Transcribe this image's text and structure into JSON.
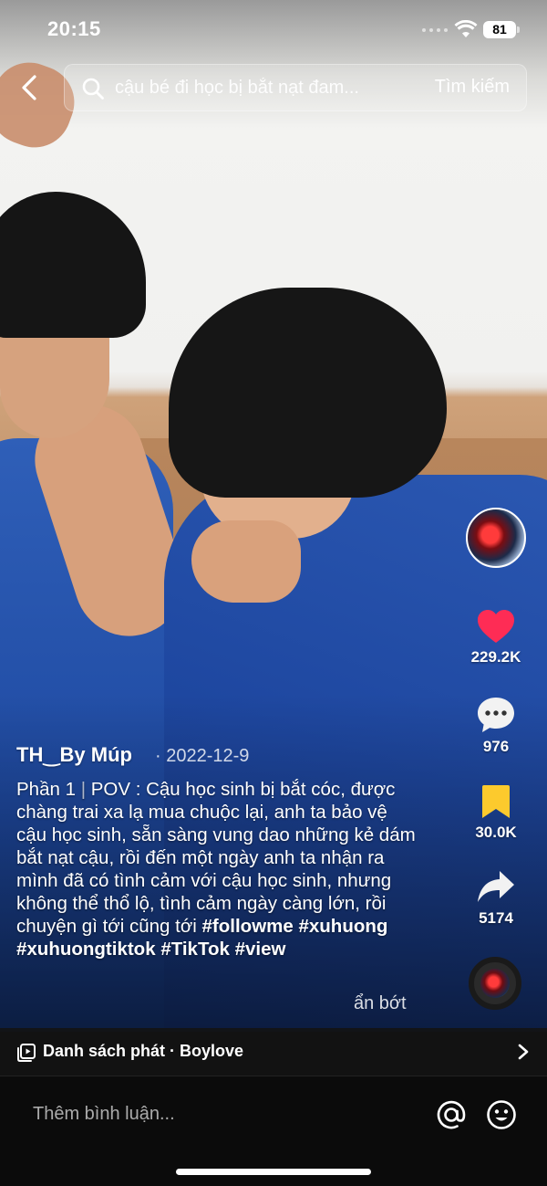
{
  "status_bar": {
    "time": "20:15",
    "battery": "81"
  },
  "search": {
    "query": "cậu bé đi học bị bắt nạt đam...",
    "button_label": "Tìm kiếm"
  },
  "rail": {
    "likes": "229.2K",
    "comments": "976",
    "saves": "30.0K",
    "shares": "5174",
    "like_color": "#fe2c55",
    "save_color": "#fcca2d"
  },
  "post": {
    "author": "TH‿By Múp",
    "date": "· 2022-12-9",
    "caption_prefix": "Phần 1",
    "caption_sep": "|",
    "caption_body": "POV : Cậu học sinh bị bắt cóc, được chàng trai xa lạ mua chuộc lại, anh ta bảo vệ cậu học sinh, sẵn sàng vung dao những kẻ dám bắt nạt cậu, rồi đến một ngày anh ta nhận ra mình đã có tình cảm với cậu học sinh, nhưng không thể thổ lộ, tình cảm ngày càng lớn, rồi chuyện gì tới cũng tới",
    "hashtags": [
      "#followme",
      "#xuhuong",
      "#xuhuongtiktok",
      "#TikTok",
      "#view"
    ],
    "see_less": "ẩn bớt"
  },
  "playlist": {
    "label": "Danh sách phát · Boylove"
  },
  "comment_bar": {
    "placeholder": "Thêm bình luận..."
  },
  "icons": {
    "back": "chevron-left-icon",
    "search": "search-icon",
    "like": "heart-icon",
    "comment": "comment-bubble-icon",
    "save": "bookmark-icon",
    "share": "share-arrow-icon",
    "playlist": "playlist-icon",
    "mention": "at-sign-icon",
    "emoji": "emoji-icon"
  }
}
